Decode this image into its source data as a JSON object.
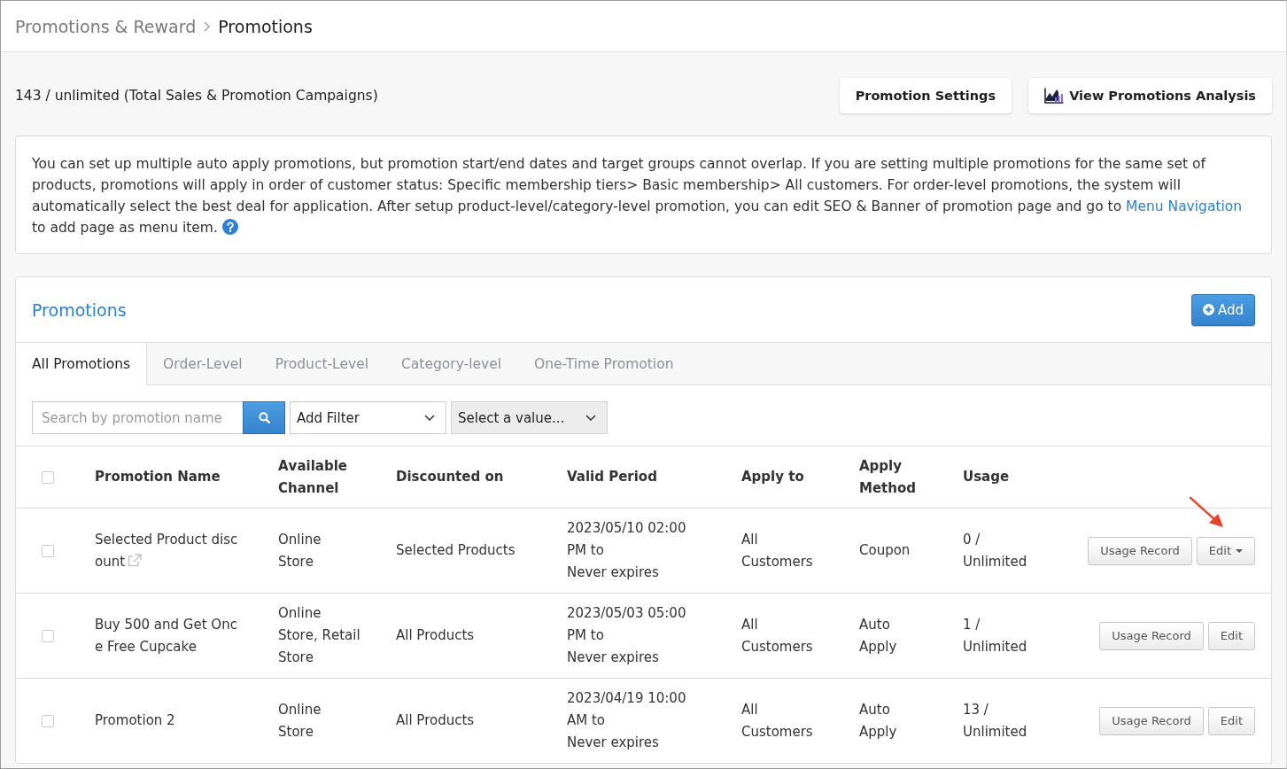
{
  "breadcrumb": {
    "items": [
      {
        "label": "Promotions & Reward",
        "current": false
      },
      {
        "label": "Promotions",
        "current": true
      }
    ]
  },
  "summary": {
    "quota": "143 / unlimited (Total Sales & Promotion Campaigns)",
    "buttons": [
      {
        "label": "Promotion Settings",
        "kind": "plain"
      },
      {
        "label": "View Promotions Analysis",
        "kind": "chart"
      }
    ]
  },
  "notice": {
    "text": "You can set up multiple auto apply promotions, but promotion start/end dates and target groups cannot overlap. If you are setting multiple promotions for the same set of products, promotions will apply in order of customer status: Specific membership tiers> Basic membership> All customers. For order-level promotions, the system will automatically select the best deal for application. After setup product-level/category-level promotion, you can edit SEO & Banner of promotion page and go to",
    "link": "Menu Navigation",
    "text_after": "to add page as menu item."
  },
  "panel": {
    "title": "Promotions",
    "add_button": "Add",
    "tabs": [
      {
        "label": "All Promotions",
        "selected": true
      },
      {
        "label": "Order-Level",
        "selected": false
      },
      {
        "label": "Product-Level",
        "selected": false
      },
      {
        "label": "Category-level",
        "selected": false
      },
      {
        "label": "One-Time Promotion",
        "selected": false
      }
    ],
    "search": {
      "placeholder": "Search by promotion name"
    },
    "filters": [
      {
        "value": "Add Filter",
        "disabled": false
      },
      {
        "value": "Select a value...",
        "disabled": true
      }
    ],
    "table": {
      "select_all": {
        "checked": false
      },
      "columns": [
        "Promotion Name",
        "Available Channel",
        "Discounted on",
        "Valid Period",
        "Apply to",
        "Apply Method",
        "Usage"
      ],
      "rows": [
        {
          "checked": false,
          "name": "Selected Product discount",
          "external_link": true,
          "channel": "Online Store",
          "discounted_on": "Selected Products",
          "valid_period": "2023/05/10 02:00 PM to\nNever expires",
          "apply_to": "All Customers",
          "apply_method": "Coupon",
          "usage": "0 / Unlimited",
          "actions": [
            {
              "label": "Usage Record",
              "dropdown": false
            },
            {
              "label": "Edit",
              "dropdown": true
            }
          ]
        },
        {
          "checked": false,
          "name": "Buy 500 and Get Once Free Cupcake",
          "external_link": false,
          "channel": "Online Store, Retail Store",
          "discounted_on": "All Products",
          "valid_period": "2023/05/03 05:00 PM to\nNever expires",
          "apply_to": "All Customers",
          "apply_method": "Auto Apply",
          "usage": "1 / Unlimited",
          "actions": [
            {
              "label": "Usage Record",
              "dropdown": false
            },
            {
              "label": "Edit",
              "dropdown": false
            }
          ]
        },
        {
          "checked": false,
          "name": "Promotion 2",
          "external_link": false,
          "channel": "Online Store",
          "discounted_on": "All Products",
          "valid_period": "2023/04/19 10:00 AM to\nNever expires",
          "apply_to": "All Customers",
          "apply_method": "Auto Apply",
          "usage": "13 / Unlimited",
          "actions": [
            {
              "label": "Usage Record",
              "dropdown": false
            },
            {
              "label": "Edit",
              "dropdown": false
            }
          ]
        }
      ]
    }
  }
}
